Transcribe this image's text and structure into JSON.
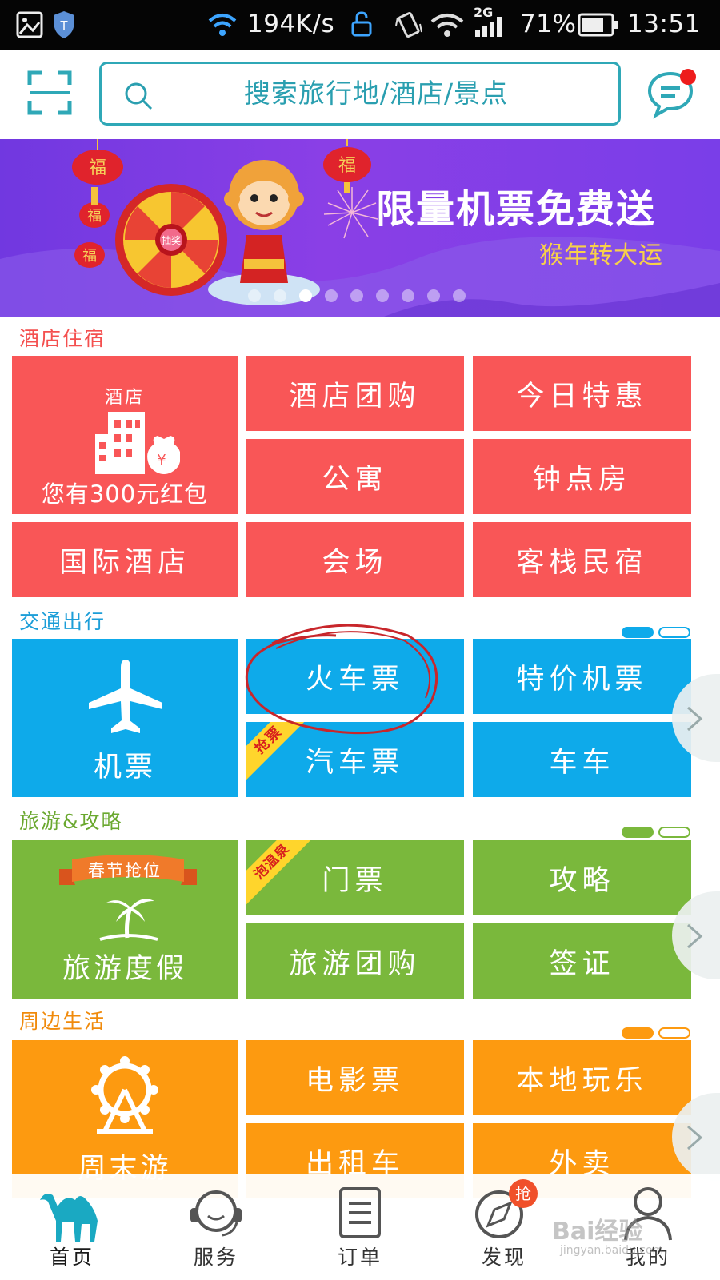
{
  "status_bar": {
    "speed": "194K/s",
    "network": "2G",
    "battery": "71%",
    "time": "13:51",
    "icons": [
      "image-icon",
      "shield-icon",
      "wifi-icon",
      "unlock-icon",
      "vibrate-icon",
      "wifi-icon",
      "signal-icon",
      "battery-icon"
    ]
  },
  "header": {
    "scan_icon": "scan-icon",
    "search_placeholder": "搜索旅行地/酒店/景点",
    "message_icon": "message-icon"
  },
  "banner": {
    "title": "限量机票免费送",
    "subtitle": "猴年转大运",
    "lantern_text": "福",
    "wheel_center": "抽奖",
    "page_count": 9,
    "active_page": 2
  },
  "sections": {
    "hotel": {
      "title": "酒店住宿",
      "color": "#f95657",
      "main_tile": {
        "top_label": "酒店",
        "bottom_label": "您有300元红包",
        "badge": "¥"
      },
      "tiles": [
        "酒店团购",
        "今日特惠",
        "公寓",
        "钟点房",
        "国际酒店",
        "会场",
        "客栈民宿"
      ]
    },
    "transport": {
      "title": "交通出行",
      "color": "#0eaaea",
      "main_tile": {
        "label": "机票"
      },
      "tiles": [
        "火车票",
        "特价机票",
        "汽车票",
        "车车"
      ],
      "tag": "抢票"
    },
    "travel": {
      "title": "旅游&攻略",
      "color": "#7ab83c",
      "main_tile": {
        "ribbon": "春节抢位",
        "label": "旅游度假"
      },
      "tiles": [
        "门票",
        "攻略",
        "旅游团购",
        "签证"
      ],
      "tag": "泡温泉"
    },
    "nearby": {
      "title": "周边生活",
      "color": "#fd9a10",
      "main_tile": {
        "label": "周末游"
      },
      "tiles": [
        "电影票",
        "本地玩乐",
        "出租车",
        "外卖"
      ]
    }
  },
  "bottom_nav": {
    "items": [
      {
        "label": "首页",
        "icon": "camel-icon",
        "active": true
      },
      {
        "label": "服务",
        "icon": "headset-icon"
      },
      {
        "label": "订单",
        "icon": "order-list-icon"
      },
      {
        "label": "发现",
        "icon": "compass-icon",
        "badge": "抢"
      },
      {
        "label": "我的",
        "icon": "profile-icon"
      }
    ]
  },
  "watermark": {
    "text": "Bai经验",
    "url_text": "jingyan.baidu.com"
  }
}
